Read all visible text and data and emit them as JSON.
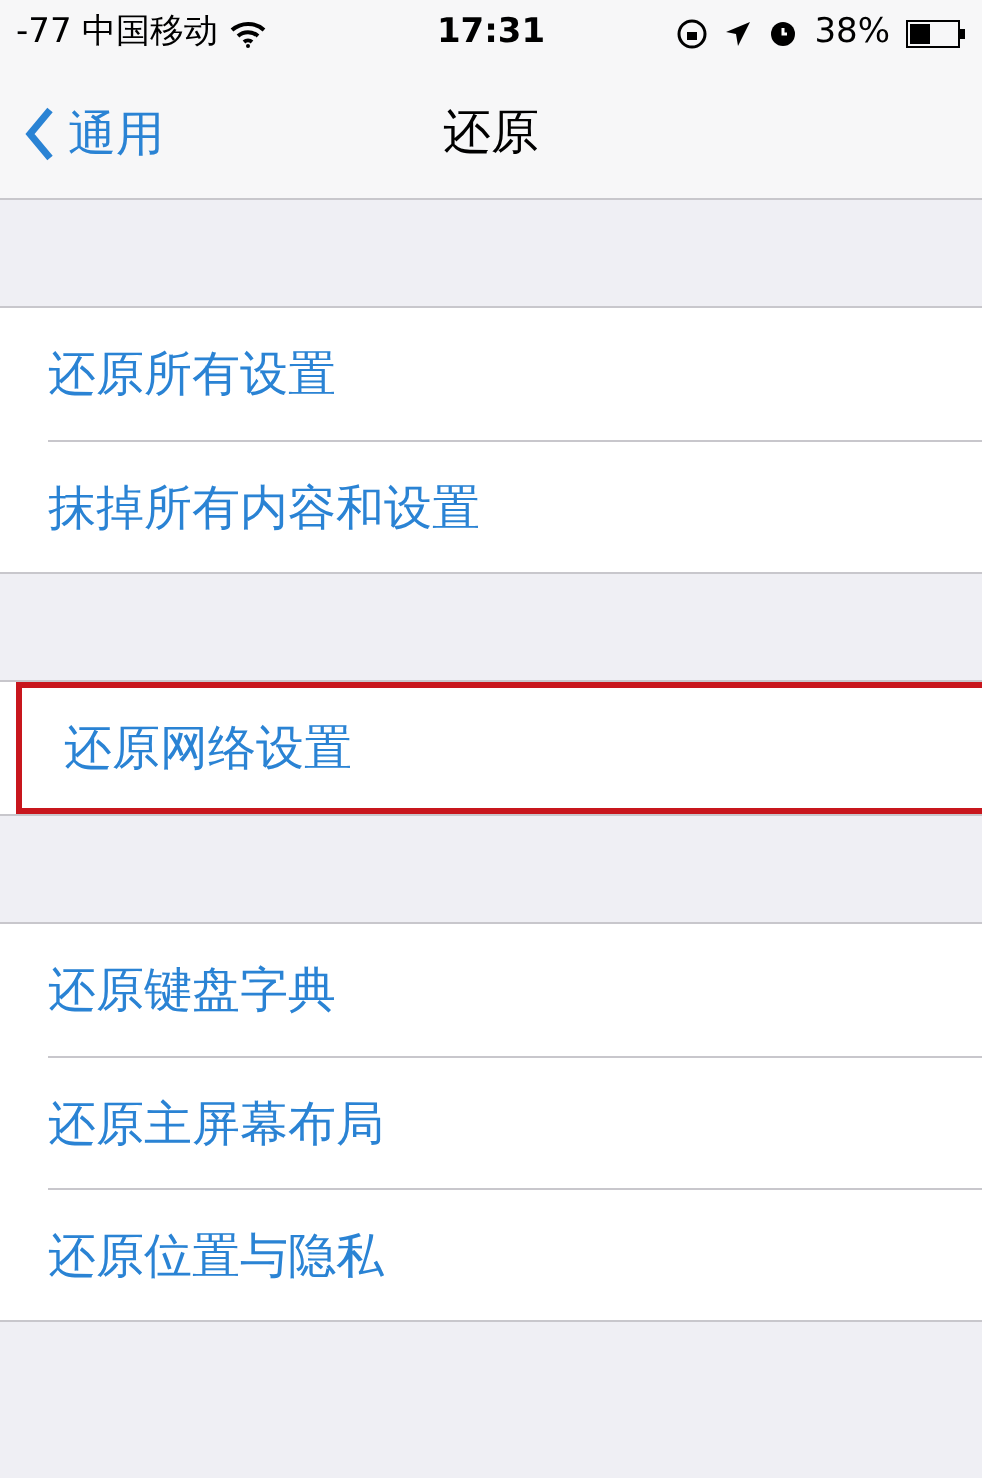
{
  "status_bar": {
    "carrier": "-77 中国移动",
    "time": "17:31",
    "battery": "38%"
  },
  "nav": {
    "back": "通用",
    "title": "还原"
  },
  "groups": [
    {
      "items": [
        {
          "label": "还原所有设置",
          "highlighted": false
        },
        {
          "label": "抹掉所有内容和设置",
          "highlighted": false
        }
      ]
    },
    {
      "items": [
        {
          "label": "还原网络设置",
          "highlighted": true
        }
      ]
    },
    {
      "items": [
        {
          "label": "还原键盘字典",
          "highlighted": false
        },
        {
          "label": "还原主屏幕布局",
          "highlighted": false
        },
        {
          "label": "还原位置与隐私",
          "highlighted": false
        }
      ]
    }
  ]
}
